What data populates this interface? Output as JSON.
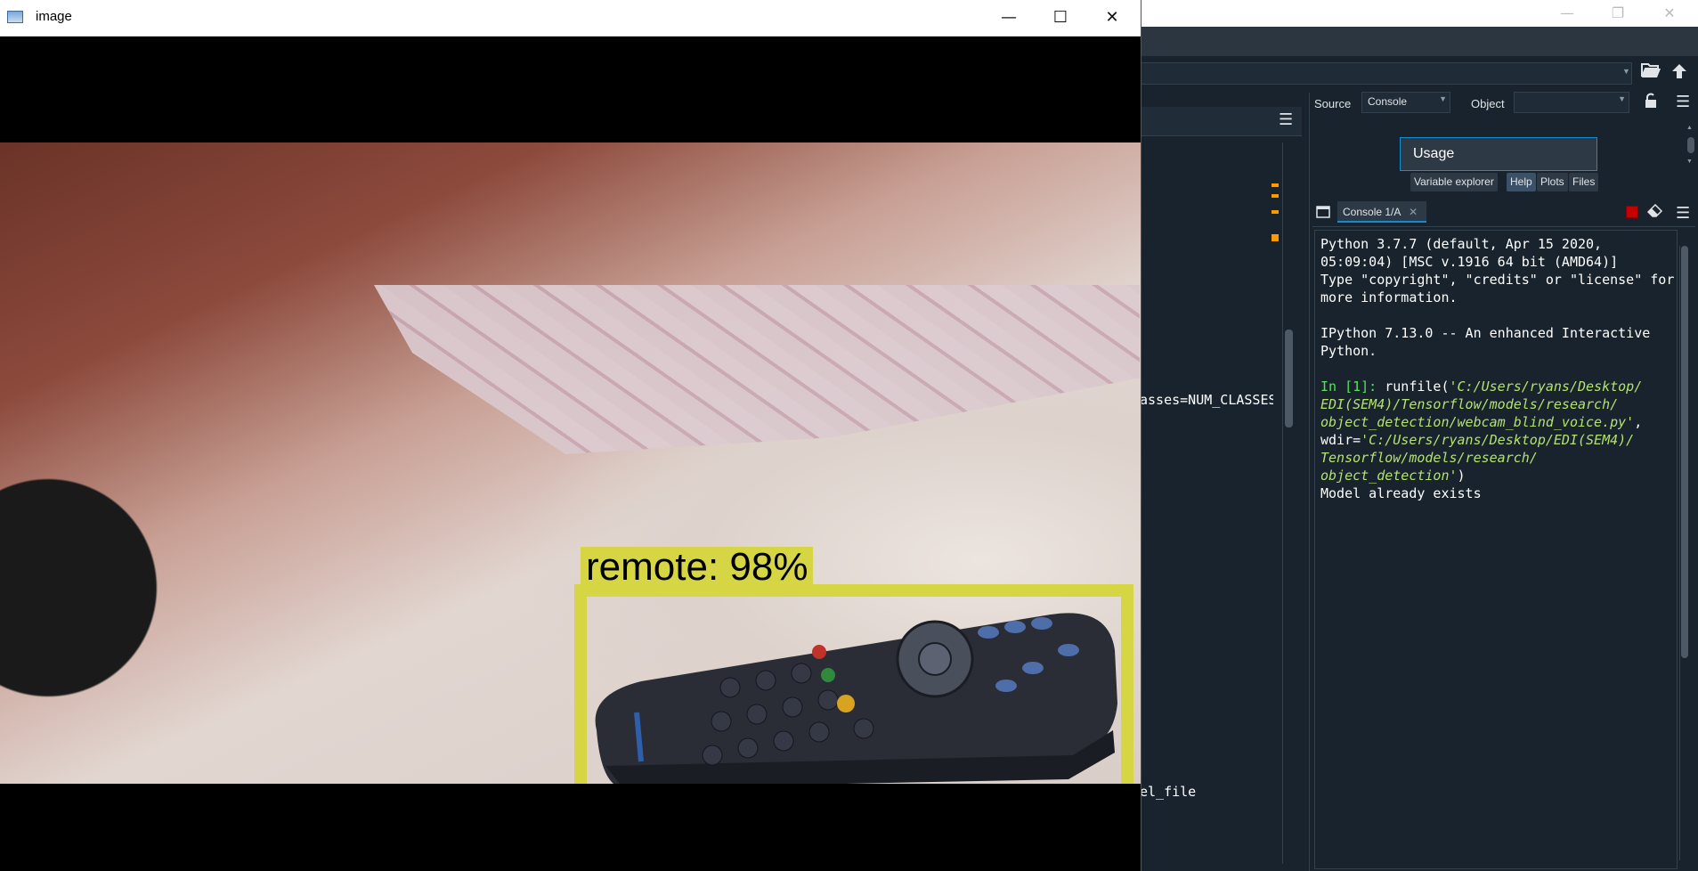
{
  "image_window": {
    "title": "image",
    "detection_label": "remote: 98%",
    "controls": {
      "minimize": "—",
      "maximize": "☐",
      "close": "✕"
    }
  },
  "spyder": {
    "window_controls": {
      "minimize": "—",
      "restore": "❐",
      "close": "✕"
    },
    "toolbar": {
      "open_icon": "folder-open-icon",
      "up_icon": "arrow-up-icon"
    },
    "editor": {
      "visible_code": [
        "asses=NUM_CLASSES",
        "el_file"
      ]
    },
    "help_pane": {
      "source_label": "Source",
      "source_value": "Console",
      "object_label": "Object",
      "object_value": "",
      "usage_title": "Usage",
      "tabs": [
        {
          "label": "Variable explorer",
          "active": false
        },
        {
          "label": "Help",
          "active": true
        },
        {
          "label": "Plots",
          "active": false
        },
        {
          "label": "Files",
          "active": false
        }
      ]
    },
    "console": {
      "tab_label": "Console 1/A",
      "tab_close": "✕",
      "banner": [
        "Python 3.7.7 (default, Apr 15 2020,",
        "05:09:04) [MSC v.1916 64 bit (AMD64)]",
        "Type \"copyright\", \"credits\" or \"license\" for",
        "more information.",
        "",
        "IPython 7.13.0 -- An enhanced Interactive",
        "Python."
      ],
      "prompt": "In [1]:",
      "command": {
        "fn": " runfile(",
        "arg1": [
          "'C:/Users/ryans/Desktop/",
          "EDI(SEM4)/Tensorflow/models/research/",
          "object_detection/webcam_blind_voice.py'"
        ],
        "sep": ",",
        "wdir_key": "wdir=",
        "arg2": [
          "'C:/Users/ryans/Desktop/EDI(SEM4)/",
          "Tensorflow/models/research/",
          "object_detection'"
        ],
        "close": ")"
      },
      "output": "Model already exists"
    }
  }
}
